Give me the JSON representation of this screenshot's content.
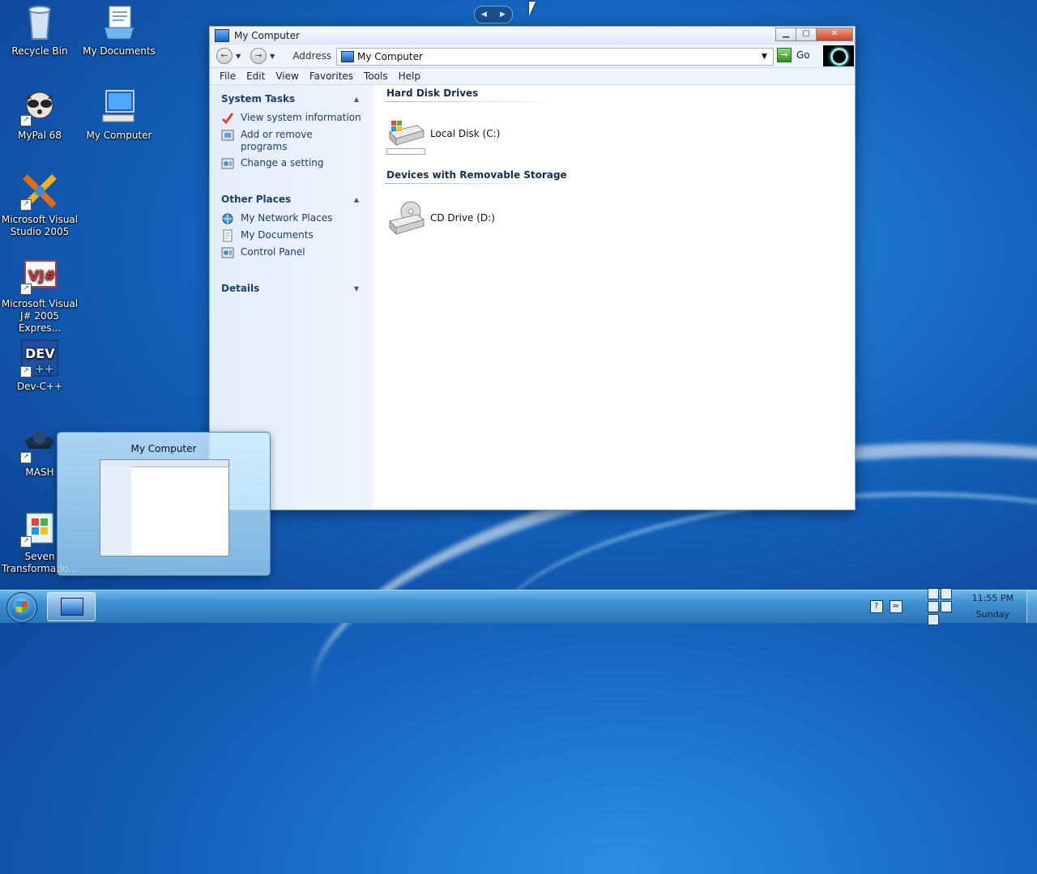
{
  "desktop": {
    "icons": [
      {
        "label": "Recycle Bin"
      },
      {
        "label": "My Documents"
      },
      {
        "label": "MyPal 68"
      },
      {
        "label": "My Computer"
      },
      {
        "label": "Microsoft Visual Studio 2005"
      },
      {
        "label": "Microsoft Visual J# 2005 Expres..."
      },
      {
        "label": "Dev-C++"
      },
      {
        "label": "MASH"
      },
      {
        "label": "Seven Transformatio..."
      }
    ]
  },
  "window": {
    "title": "My Computer",
    "address_label": "Address",
    "address_value": "My Computer",
    "go_label": "Go",
    "menu": [
      "File",
      "Edit",
      "View",
      "Favorites",
      "Tools",
      "Help"
    ],
    "sidebar": {
      "system_tasks": {
        "title": "System Tasks",
        "items": [
          "View system information",
          "Add or remove programs",
          "Change a setting"
        ]
      },
      "other_places": {
        "title": "Other Places",
        "items": [
          "My Network Places",
          "My Documents",
          "Control Panel"
        ]
      },
      "details": {
        "title": "Details"
      }
    },
    "groups": {
      "hard_disk": {
        "title": "Hard Disk Drives",
        "drive": "Local Disk (C:)"
      },
      "removable": {
        "title": "Devices with Removable Storage",
        "drive": "CD Drive (D:)"
      }
    }
  },
  "thumbnail": {
    "title": "My Computer"
  },
  "taskbar": {
    "clock_time": "11:55 PM",
    "clock_day": "Sunday"
  }
}
